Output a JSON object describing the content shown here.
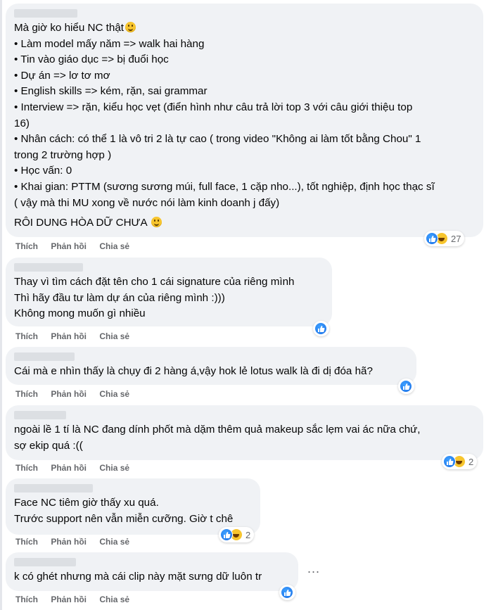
{
  "colors": {
    "bubble": "#f0f2f5",
    "muted": "#65676b",
    "like": "#1877f2",
    "haha": "#f7c52e"
  },
  "actions": {
    "like": "Thích",
    "reply": "Phản hồi",
    "share": "Chia sẻ"
  },
  "comments": [
    {
      "lines": [
        "Mà giờ ko hiểu NC thật",
        "• Làm model mấy năm => walk hai hàng",
        "• Tin vào giáo dục => bị đuổi học",
        "• Dự án => lơ tơ mơ",
        "• English skills => kém, rặn, sai grammar",
        "• Interview => rặn, kiểu học vẹt (điển hình như câu trả lời top 3 với câu giới thiệu top",
        "16)",
        "• Nhân cách: có thể 1 là vô tri 2 là tự cao ( trong video \"Không ai làm tốt bằng Chou\" 1",
        "trong 2 trường hợp )",
        "• Học vấn: 0",
        "• Khai gian: PTTM (sương sương múi, full face, 1 cặp nho...), tốt nghiệp, định học thạc sĩ",
        "( vậy mà thi MU xong về nước nói làm kinh doanh j đấy)",
        "RÔI DUNG HÒA DỮ CHƯA"
      ],
      "reaction_count": "27"
    },
    {
      "lines": [
        "Thay vì tìm cách đặt tên cho 1 cái signature của riêng mình",
        "Thì hãy đầu tư làm dự án của riêng mình :)))",
        "Không mong muốn gì nhiều"
      ],
      "reaction_count": ""
    },
    {
      "lines": [
        "Cái mà e nhìn thấy là chụy đi 2 hàng á,vậy hok lẻ lotus walk là đi dị đóa hã?"
      ],
      "reaction_count": ""
    },
    {
      "lines": [
        "ngoài lề 1 tí là NC đang dính phốt mà dặm thêm quả makeup sắc lẹm vai ác nữa chứ,",
        "sợ ekip quá :(("
      ],
      "reaction_count": "2"
    },
    {
      "lines": [
        "Face NC tiêm giờ thấy xu quá.",
        "Trước support nên vẫn miễn cưỡng. Giờ t chê"
      ],
      "reaction_count": "2"
    },
    {
      "lines": [
        "k có ghét nhưng mà cái clip này mặt sưng dữ luôn tr"
      ],
      "reaction_count": ""
    }
  ],
  "more_options": "..."
}
